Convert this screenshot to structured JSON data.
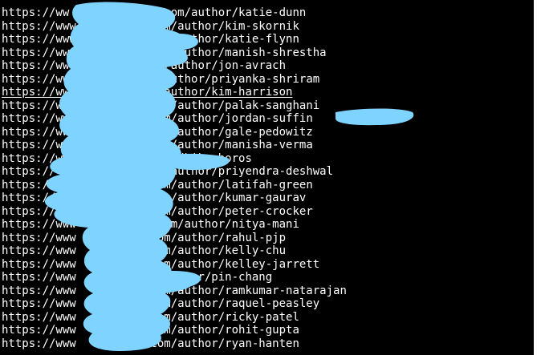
{
  "theme": {
    "background": "#000000",
    "text": "#ffffff",
    "redaction": "#7fd3ff"
  },
  "lines": [
    {
      "prefix": "https://ww",
      "suffix": "t.com/author/katie-dunn"
    },
    {
      "prefix": "https://www",
      "suffix": "com/author/kim-skornik"
    },
    {
      "prefix": "https://www",
      "suffix": "com/author/katie-flynn"
    },
    {
      "prefix": "https://www",
      "suffix": "com/author/manish-shrestha"
    },
    {
      "prefix": "https://ww",
      "suffix": "om/author/jon-avrach"
    },
    {
      "prefix": "https://ww",
      "suffix": "m/author/priyanka-shriram"
    },
    {
      "prefix": "https://ww",
      "suffix": "m/author/kim-harrison"
    },
    {
      "prefix": "https://ww",
      "suffix": "com/author/palak-sanghani"
    },
    {
      "prefix": "https://ww",
      "suffix": "com/author/jordan-suffin"
    },
    {
      "prefix": "https://ww",
      "suffix": "com/author/gale-pedowitz"
    },
    {
      "prefix": "https://ww",
      "suffix": "com/author/manisha-verma"
    },
    {
      "prefix": "https://www",
      "suffix": "r/radhika-boros"
    },
    {
      "prefix": "https://",
      "suffix": "om/author/priyendra-deshwal"
    },
    {
      "prefix": "https://",
      "suffix": "com/author/latifah-green"
    },
    {
      "prefix": "https://",
      "suffix": "com/author/kumar-gaurav"
    },
    {
      "prefix": "https://www",
      "suffix": "com/author/peter-crocker"
    },
    {
      "prefix": "https://www",
      "suffix": ".com/author/nitya-mani"
    },
    {
      "prefix": "https://www",
      "suffix": "com/author/rahul-pjp"
    },
    {
      "prefix": "https://www",
      "suffix": "com/author/kelly-chu"
    },
    {
      "prefix": "https://www",
      "suffix": "com/author/kelley-jarrett"
    },
    {
      "prefix": "https://www",
      "suffix": "m/author/pin-chang"
    },
    {
      "prefix": "https://www",
      "suffix": "com/author/ramkumar-natarajan"
    },
    {
      "prefix": "https://www",
      "suffix": "com/author/raquel-peasley"
    },
    {
      "prefix": "https://www",
      "suffix": "com/author/ricky-patel"
    },
    {
      "prefix": "https://www",
      "suffix": "com/author/rohit-gupta"
    },
    {
      "prefix": "https://www",
      "suffix": "com/author/ryan-hanten"
    }
  ]
}
